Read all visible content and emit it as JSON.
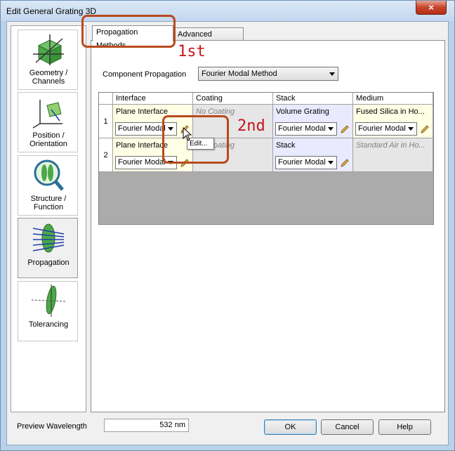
{
  "window": {
    "title": "Edit General Grating 3D",
    "close_glyph": "×"
  },
  "sidebar": {
    "items": [
      {
        "label_line1": "Geometry /",
        "label_line2": "Channels",
        "icon": "geometry-channels-icon"
      },
      {
        "label_line1": "Position /",
        "label_line2": "Orientation",
        "icon": "position-orientation-icon"
      },
      {
        "label_line1": "Structure /",
        "label_line2": "Function",
        "icon": "structure-function-icon"
      },
      {
        "label_line1": "Propagation",
        "label_line2": "",
        "icon": "propagation-icon",
        "active": true
      },
      {
        "label_line1": "Tolerancing",
        "label_line2": "",
        "icon": "tolerancing-icon"
      }
    ]
  },
  "tabs": [
    {
      "label": "Propagation Methods",
      "active": true
    },
    {
      "label": "Advanced Settings",
      "active": false
    }
  ],
  "component_propagation": {
    "label": "Component Propagation",
    "value": "Fourier Modal Method"
  },
  "grid": {
    "columns": [
      "Interface",
      "Coating",
      "Stack",
      "Medium"
    ],
    "rows": [
      {
        "index": "1",
        "interface": {
          "text": "Plane Interface",
          "method": "Fourier Modal"
        },
        "coating": {
          "text": "No Coating"
        },
        "stack": {
          "text": "Volume Grating",
          "method": "Fourier Modal"
        },
        "medium": {
          "text": "Fused Silica in Ho...",
          "method": "Fourier Modal"
        }
      },
      {
        "index": "2",
        "interface": {
          "text": "Plane Interface",
          "method": "Fourier Modal"
        },
        "coating": {
          "text": "No Coating"
        },
        "stack": {
          "text": "Stack",
          "method": "Fourier Modal"
        },
        "medium": {
          "text": "Standard Air in Ho..."
        }
      }
    ]
  },
  "tooltip": {
    "text": "Edit..."
  },
  "annotations": {
    "first": "1st",
    "second": "2nd",
    "color": "#c3161c"
  },
  "preview_wavelength": {
    "label": "Preview Wavelength",
    "value": "532 nm"
  },
  "buttons": {
    "ok": "OK",
    "cancel": "Cancel",
    "help": "Help"
  }
}
